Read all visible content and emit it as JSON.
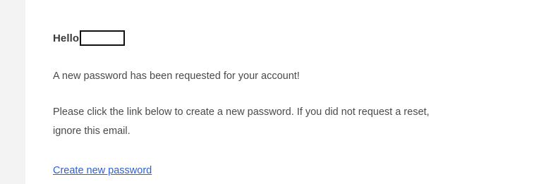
{
  "email": {
    "greeting": "Hello",
    "line1": "A new password has been requested for your account!",
    "line2": "Please click the link below to create a new password. If you did not request a reset,",
    "line3": "ignore this email.",
    "link_label": "Create new password"
  },
  "colors": {
    "background": "#f3f3f4",
    "card": "#ffffff",
    "text": "#4a4a4a",
    "heading": "#3a3a3a",
    "link": "#2f5fd0"
  }
}
